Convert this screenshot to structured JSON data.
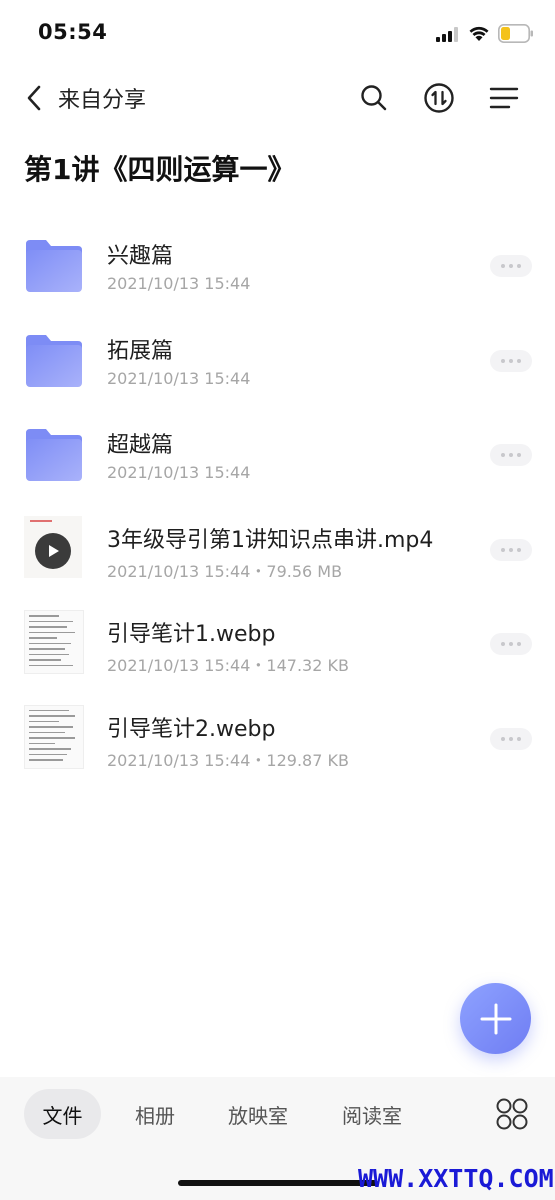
{
  "status_bar": {
    "time": "05:54"
  },
  "nav": {
    "back_label": "来自分享",
    "icons": [
      "chevron-left-icon",
      "search-icon",
      "transfer-icon",
      "menu-icon"
    ]
  },
  "page_title": "第1讲《四则运算一》",
  "files": [
    {
      "name": "兴趣篇",
      "meta": "2021/10/13 15:44",
      "type": "folder"
    },
    {
      "name": "拓展篇",
      "meta": "2021/10/13 15:44",
      "type": "folder"
    },
    {
      "name": "超越篇",
      "meta": "2021/10/13 15:44",
      "type": "folder"
    },
    {
      "name": "3年级导引第1讲知识点串讲.mp4",
      "meta": "2021/10/13 15:44・79.56 MB",
      "type": "video"
    },
    {
      "name": "引导笔计1.webp",
      "meta": "2021/10/13 15:44・147.32 KB",
      "type": "image"
    },
    {
      "name": "引导笔计2.webp",
      "meta": "2021/10/13 15:44・129.87 KB",
      "type": "image"
    }
  ],
  "tabs": [
    {
      "label": "文件",
      "active": true
    },
    {
      "label": "相册",
      "active": false
    },
    {
      "label": "放映室",
      "active": false
    },
    {
      "label": "阅读室",
      "active": false
    }
  ],
  "watermark": "WWW.XXTTQ.COM",
  "colors": {
    "folder": "#8f9cf7",
    "fab": "#7a88f5",
    "watermark": "#1a1ad6"
  }
}
